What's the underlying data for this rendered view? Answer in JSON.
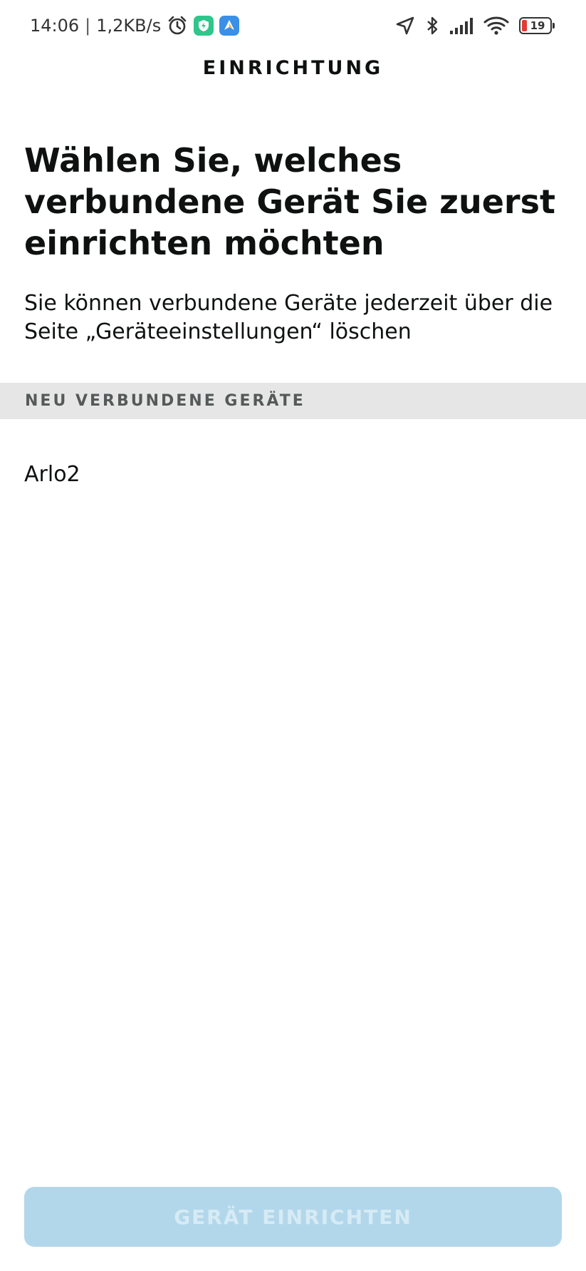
{
  "status_bar": {
    "time": "14:06",
    "separator": "|",
    "network_speed": "1,2KB/s",
    "icons_left": [
      "alarm-icon",
      "shield-app-icon",
      "maps-app-icon"
    ],
    "icons_right": [
      "location-icon",
      "bluetooth-icon",
      "signal-icon",
      "wifi-icon",
      "battery-icon"
    ],
    "battery_level": "19",
    "battery_color": "#e53935"
  },
  "header": {
    "title": "EINRICHTUNG"
  },
  "main": {
    "heading": "Wählen Sie, welches verbundene Gerät Sie zuerst einrichten möchten",
    "subtext": "Sie können verbundene Geräte jederzeit über die Seite „Geräteeinstellungen“ löschen"
  },
  "section": {
    "label": "NEU VERBUNDENE GERÄTE"
  },
  "devices": [
    {
      "name": "Arlo2"
    }
  ],
  "footer": {
    "button_label": "GERÄT EINRICHTEN",
    "button_state": "disabled",
    "button_color": "#b3d7ea"
  }
}
